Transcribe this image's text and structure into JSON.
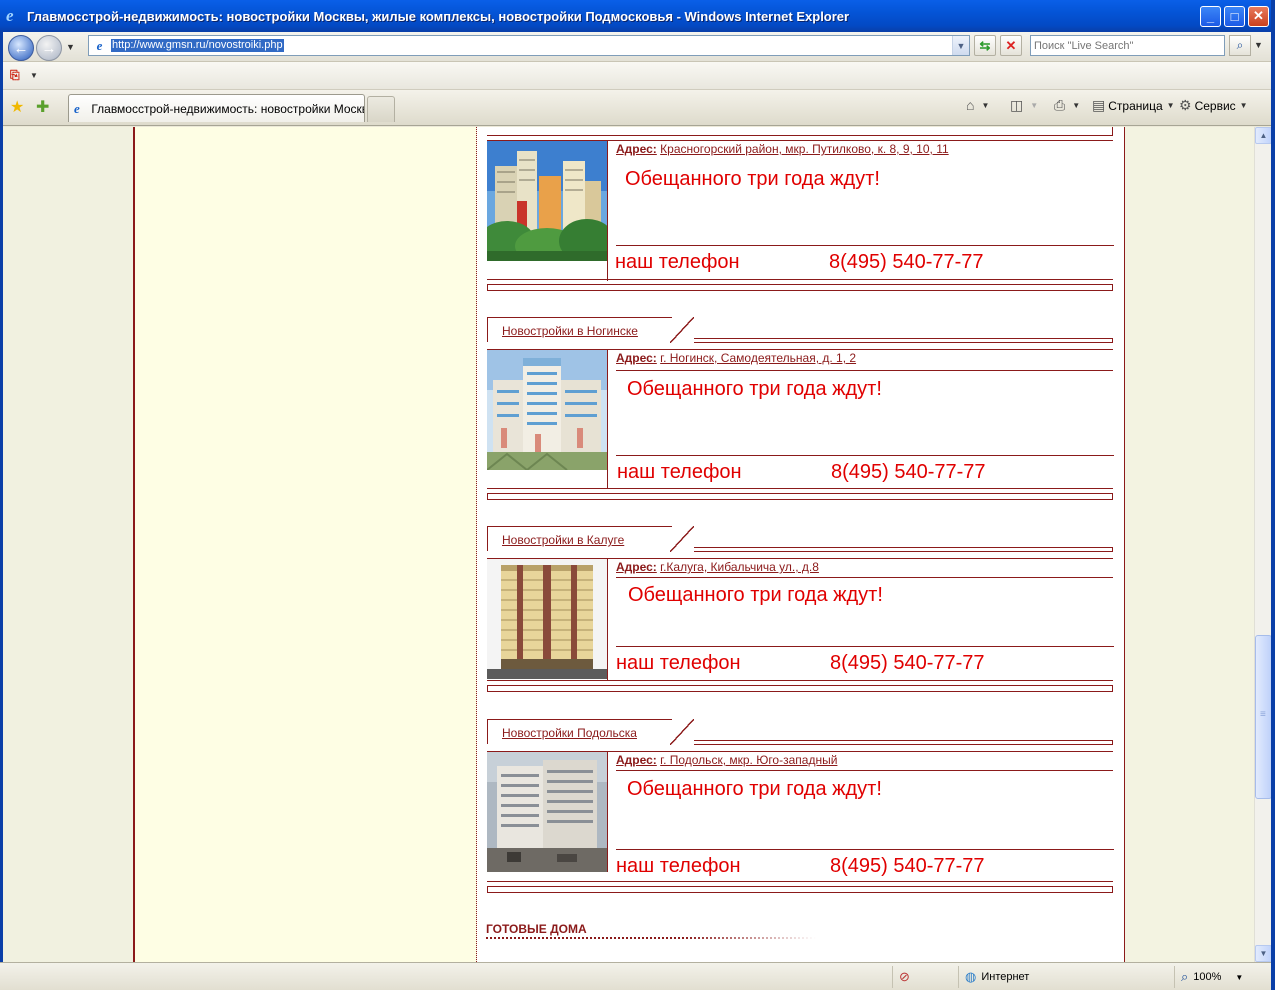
{
  "window": {
    "title": "Главмосстрой-недвижимость: новостройки Москвы, жилые комплексы, новостройки Подмосковья - Windows Internet Explorer",
    "minimize": "_",
    "maximize": "□",
    "close": "✕"
  },
  "address_bar": {
    "url": "http://www.gmsn.ru/novostroiki.php",
    "search_placeholder": "Поиск \"Live Search\""
  },
  "tab": {
    "label": "Главмосстрой-недвижимость: новостройки Москв..."
  },
  "command_bar": {
    "page_label": "Страница",
    "tools_label": "Сервис"
  },
  "listings": [
    {
      "header": "",
      "address_label": "Адрес:",
      "address": "Красногорский район, мкр. Путилково, к. 8, 9, 10, 11",
      "slogan": "Обещанного три года ждут!",
      "phone_label": "наш телефон",
      "phone": "8(495) 540-77-77"
    },
    {
      "header": "Новостройки в Ногинске",
      "address_label": "Адрес:",
      "address": "г. Ногинск, Самодеятельная, д. 1, 2",
      "slogan": "Обещанного три года ждут!",
      "phone_label": "наш телефон",
      "phone": "8(495) 540-77-77"
    },
    {
      "header": "Новостройки в Калуге",
      "address_label": "Адрес:",
      "address": "г.Калуга, Кибальчича ул., д.8",
      "slogan": "Обещанного три года ждут!",
      "phone_label": "наш телефон",
      "phone": "8(495) 540-77-77"
    },
    {
      "header": "Новостройки Подольска",
      "address_label": "Адрес:",
      "address": "г. Подольск, мкр. Юго-западный",
      "slogan": "Обещанного три года ждут!",
      "phone_label": "наш телефон",
      "phone": "8(495) 540-77-77"
    }
  ],
  "ready_homes_title": "ГОТОВЫЕ ДОМА",
  "status_bar": {
    "zone": "Интернет",
    "zoom": "100%"
  },
  "colors": {
    "accent": "#8b1a1a",
    "slogan": "#e00000",
    "sidebar": "#fefee4"
  }
}
